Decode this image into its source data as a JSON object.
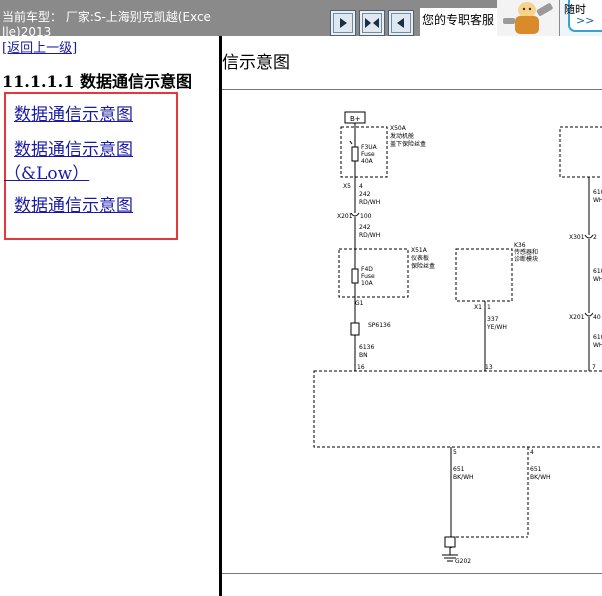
{
  "header": {
    "vehicle_label": "当前车型： 厂家:S-上海别克凯越(Excelle)2013",
    "nav_buttons": [
      {
        "name": "prev-page-button",
        "icon": "arrow-right-icon"
      },
      {
        "name": "split-view-button",
        "icon": "split-arrows-icon"
      },
      {
        "name": "next-page-button",
        "icon": "arrow-left-icon"
      }
    ],
    "assistant_text": "您的专职客服",
    "right_text": "随时",
    "right_link": ">>"
  },
  "sidebar": {
    "back_link": "[返回上一级]",
    "section_heading": "11.1.1.1 数据通信示意图",
    "links": [
      {
        "label": "数据通信示意图"
      },
      {
        "label": "数据通信示意图"
      },
      {
        "label": "（&Low）"
      },
      {
        "label": "数据通信示意图"
      }
    ]
  },
  "content": {
    "title": "信示意图"
  },
  "diagram": {
    "labels": {
      "bplus": "B+",
      "x50a": "X50A",
      "x50a_desc1": "发动机舱",
      "x50a_desc2": "盖下保险丝盒",
      "f3ua": "F3UA",
      "fuse1": "Fuse",
      "amp1": "40A",
      "x5": "X5",
      "x5_pin": "4",
      "w242a": "242",
      "rdwh_a": "RD/WH",
      "x201a": "X201",
      "x201a_pin": "100",
      "w242b": "242",
      "rdwh_b": "RD/WH",
      "x51a": "X51A",
      "x51a_desc1": "仪表板",
      "x51a_desc2": "保险丝盒",
      "f4d": "F4D",
      "fuse2": "Fuse",
      "amp2": "10A",
      "g1": "G1",
      "sp6136": "SP6136",
      "w6136": "6136",
      "bn": "BN",
      "pin16": "16",
      "k36": "K36",
      "k36_desc1": "传感器和",
      "k36_desc2": "诊断模块",
      "x1": "X1",
      "x1_pin": "1",
      "w337": "337",
      "yewh": "YE/WH",
      "pin13": "13",
      "w610a": "610",
      "wh_a": "WH",
      "x301": "X301",
      "x301_pin": "2",
      "w610b": "610",
      "wh_b": "WH",
      "x201b": "X201",
      "x201b_pin": "40",
      "w610c": "610",
      "wh_c": "WH",
      "pin7": "7",
      "pin5": "5",
      "pin4": "4",
      "w651a": "651",
      "bkwh_a": "BK/WH",
      "w651b": "651",
      "bkwh_b": "BK/WH",
      "g202": "G202"
    }
  }
}
